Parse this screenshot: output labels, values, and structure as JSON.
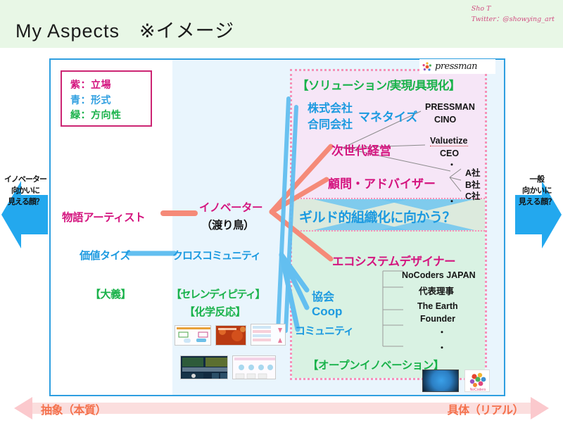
{
  "header": {
    "title": "My Aspects　※イメージ",
    "credit_name": "Sho T",
    "credit_twitter": "Twitter：@showying_art"
  },
  "legend": {
    "items": [
      {
        "label": "紫：立場",
        "color": "#d4157f"
      },
      {
        "label": "青：形式",
        "color": "#1c9ae0"
      },
      {
        "label": "緑：方向性",
        "color": "#19b24a"
      }
    ]
  },
  "brand": {
    "logo_text": "pressman"
  },
  "side_arrows": {
    "left_caption": "イノベーター\n向かいに\n見える顔？",
    "left_line1": "イノベーター",
    "left_line2": "向かいに",
    "left_line3": "見える顔？",
    "right_line1": "一般",
    "right_line2": "向かいに",
    "right_line3": "見える顔？",
    "color": "#23a8ee"
  },
  "axis": {
    "left_label": "抽象（本質）",
    "right_label": "具体（リアル）",
    "color": "#f4714c",
    "band_color": "#fde3e3"
  },
  "center": {
    "innovator": "イノベーター",
    "innovator_sub": "（渡り鳥）",
    "monogatari_artist": "物語アーティスト",
    "kachi_tize": "価値タイズ",
    "cross_community": "クロスコミュニティ",
    "taigi": "【大義】",
    "serendipity": "【セレンディピティ】",
    "kagaku_hanno": "【化学反応】"
  },
  "zone_solution": {
    "heading": "【ソリューション/実現/具現化】",
    "kabushiki": "株式会社",
    "godo": "合同会社",
    "monetize": "マネタイズ",
    "jisedai": "次世代経営",
    "komon": "顧問・アドバイザー",
    "right_items": {
      "pressman": "PRESSMAN",
      "cino": "CINO",
      "valuetize": "Valuetize",
      "ceo": "CEO",
      "dot1": "・",
      "company_a": "A社",
      "company_b": "B社",
      "company_c": "C社",
      "dot2": "・"
    }
  },
  "zone_guild": {
    "heading": "ギルド的組織化に向かう？",
    "bg_color": "#dceadd",
    "arrow_color": "#6fc5f0"
  },
  "zone_eco": {
    "heading": "エコシステムデザイナー",
    "kyokai": "協会",
    "coop": "Coop",
    "community": "コミュニティ",
    "open_innovation": "【オープンイノベーション】",
    "right_items": {
      "nocoders": "NoCoders JAPAN",
      "daihyo": "代表理事",
      "earth": "The Earth",
      "founder": "Founder",
      "dot3": "・",
      "dot4": "・"
    }
  },
  "colors": {
    "header_band": "#e8f7e6",
    "frame_border": "#2f9fe0",
    "blue_field": "#e9f5fd",
    "pink_dotted": "#f791b8",
    "lilac": "#f6e6f7",
    "mint": "#d9f2e3",
    "salmon_line": "#f58a78",
    "blue_line": "#63bff0"
  }
}
